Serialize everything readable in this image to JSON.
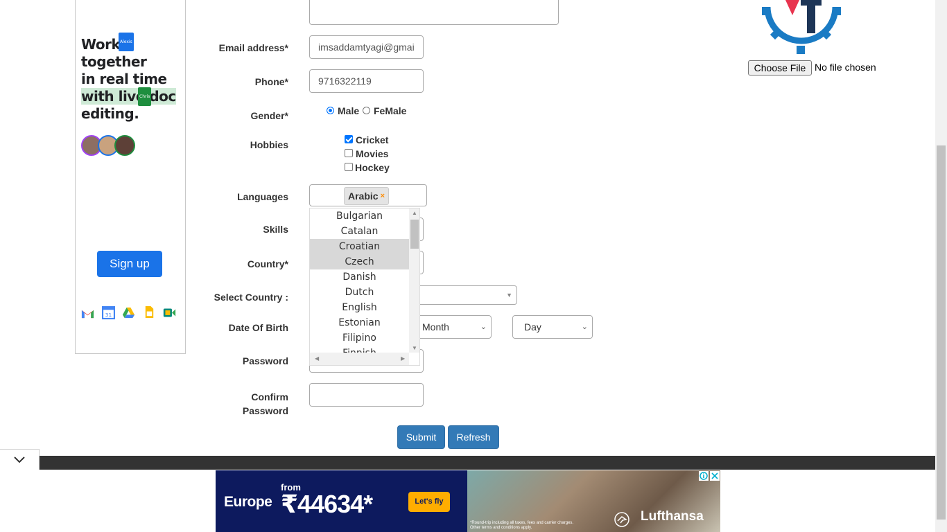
{
  "left_ad": {
    "headline_lines": [
      "Work",
      "together",
      "in real time",
      "with live doc",
      "editing."
    ],
    "tag_top": "Alexis",
    "tag_mid": "Chris",
    "cta": "Sign up",
    "app_icons": [
      "gmail-icon",
      "calendar-icon",
      "drive-icon",
      "docs-icon",
      "meet-icon"
    ],
    "calendar_day": "31"
  },
  "form": {
    "email": {
      "label": "Email address*",
      "value": "imsaddamtyagi@gmai"
    },
    "phone": {
      "label": "Phone*",
      "value": "9716322119"
    },
    "gender": {
      "label": "Gender*",
      "options": [
        "Male",
        "FeMale"
      ],
      "selected": "Male"
    },
    "hobbies": {
      "label": "Hobbies",
      "options": [
        {
          "text": "Cricket",
          "checked": true
        },
        {
          "text": "Movies",
          "checked": false
        },
        {
          "text": "Hockey",
          "checked": false
        }
      ]
    },
    "languages": {
      "label": "Languages",
      "selected_chip": "Arabic",
      "remove_glyph": "×",
      "dropdown": [
        "Bulgarian",
        "Catalan",
        "Croatian",
        "Czech",
        "Danish",
        "Dutch",
        "English",
        "Estonian",
        "Filipino",
        "Finnish"
      ],
      "highlighted": [
        "Croatian",
        "Czech"
      ]
    },
    "skills": {
      "label": "Skills"
    },
    "country": {
      "label": "Country*"
    },
    "select_country": {
      "label": "Select Country :"
    },
    "dob": {
      "label": "Date Of Birth",
      "month": "Month",
      "day": "Day"
    },
    "password": {
      "label": "Password"
    },
    "confirm_password": {
      "label_line1": "Confirm",
      "label_line2": "Password"
    },
    "submit": "Submit",
    "refresh": "Refresh"
  },
  "file_input": {
    "button": "Choose File",
    "status": "No file chosen"
  },
  "bottom_ad": {
    "destination": "Europe",
    "from": "from",
    "price": "₹44634*",
    "cta": "Let's fly",
    "brand": "Lufthansa",
    "fine_print_1": "*Round-trip including all taxes, fees and carrier charges.",
    "fine_print_2": "Other terms and conditions apply.",
    "colors": {
      "navy": "#0d1a5e",
      "yellow": "#ffad00"
    }
  },
  "colors": {
    "primary_button": "#337ab7",
    "signup": "#1a73e8",
    "logo_blue": "#1a7bc4",
    "logo_red": "#e8344e",
    "logo_navy": "#1d3557"
  }
}
